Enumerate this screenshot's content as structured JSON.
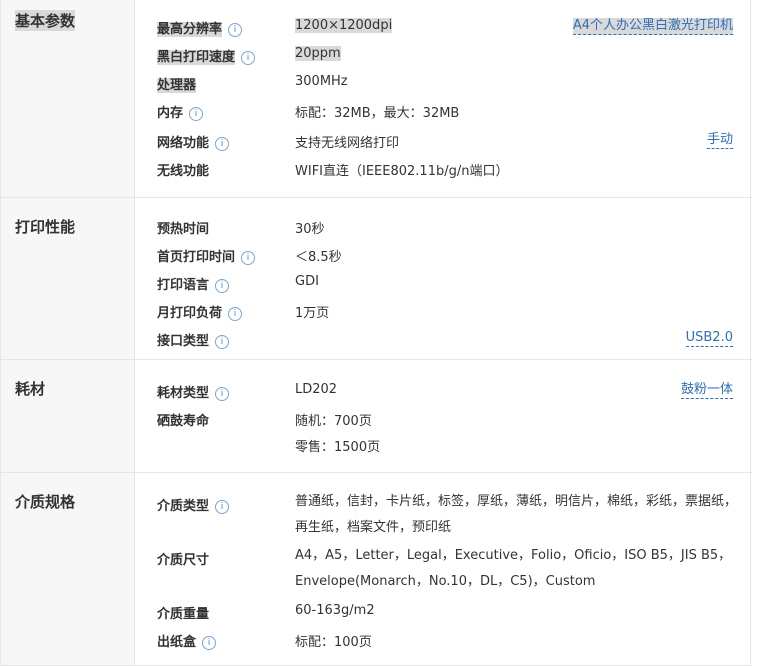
{
  "sections": [
    {
      "title": "基本参数",
      "rows": [
        {
          "label": "最高分辨率",
          "value": "1200×1200dpi",
          "link": "A4个人办公黑白激光打印机"
        },
        {
          "label": "黑白打印速度",
          "value": "20ppm"
        },
        {
          "label": "处理器",
          "value": "300MHz"
        },
        {
          "label": "内存",
          "value": "标配：32MB，最大：32MB"
        },
        {
          "label": "网络功能",
          "value": "支持无线网络打印",
          "link": "手动"
        },
        {
          "label": "无线功能",
          "value": "WIFI直连（IEEE802.11b/g/n端口）"
        }
      ]
    },
    {
      "title": "打印性能",
      "rows": [
        {
          "label": "预热时间",
          "value": "30秒"
        },
        {
          "label": "首页打印时间",
          "value": "＜8.5秒"
        },
        {
          "label": "打印语言",
          "value": "GDI"
        },
        {
          "label": "月打印负荷",
          "value": "1万页"
        },
        {
          "label": "接口类型",
          "value": "",
          "link": "USB2.0"
        }
      ]
    },
    {
      "title": "耗材",
      "rows": [
        {
          "label": "耗材类型",
          "value": "LD202",
          "link": "鼓粉一体"
        },
        {
          "label": "硒鼓寿命",
          "value": "随机：700页",
          "value2": "零售：1500页"
        }
      ]
    },
    {
      "title": "介质规格",
      "rows": [
        {
          "label": "介质类型",
          "value": "普通纸，信封，卡片纸，标签，厚纸，薄纸，明信片，棉纸，彩纸，票据纸，再生纸，档案文件，预印纸"
        },
        {
          "label": "介质尺寸",
          "value": "A4，A5，Letter，Legal，Executive，Folio，Oficio，ISO B5，JIS B5，Envelope(Monarch，No.10，DL，C5)，Custom"
        },
        {
          "label": "介质重量",
          "value": "60-163g/m2"
        },
        {
          "label": "出纸盒",
          "value": "标配：100页"
        }
      ]
    }
  ],
  "info_icon": "info-icon"
}
